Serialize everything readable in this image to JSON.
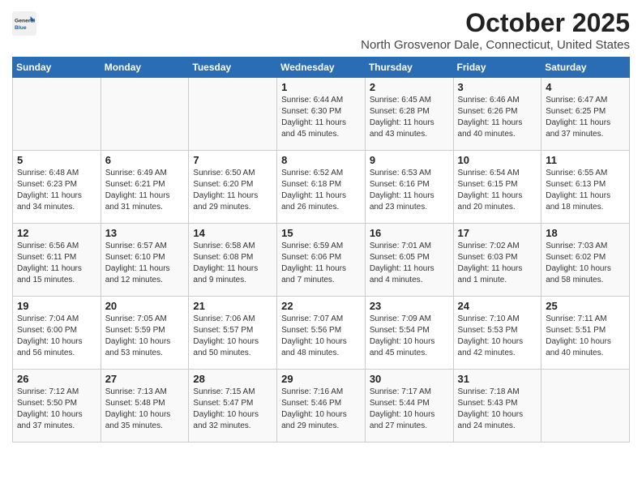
{
  "header": {
    "logo": {
      "general": "General",
      "blue": "Blue"
    },
    "month": "October 2025",
    "location": "North Grosvenor Dale, Connecticut, United States"
  },
  "days_of_week": [
    "Sunday",
    "Monday",
    "Tuesday",
    "Wednesday",
    "Thursday",
    "Friday",
    "Saturday"
  ],
  "weeks": [
    [
      {
        "day": "",
        "empty": true
      },
      {
        "day": "",
        "empty": true
      },
      {
        "day": "",
        "empty": true
      },
      {
        "day": "1",
        "sunrise": "6:44 AM",
        "sunset": "6:30 PM",
        "daylight": "11 hours and 45 minutes."
      },
      {
        "day": "2",
        "sunrise": "6:45 AM",
        "sunset": "6:28 PM",
        "daylight": "11 hours and 43 minutes."
      },
      {
        "day": "3",
        "sunrise": "6:46 AM",
        "sunset": "6:26 PM",
        "daylight": "11 hours and 40 minutes."
      },
      {
        "day": "4",
        "sunrise": "6:47 AM",
        "sunset": "6:25 PM",
        "daylight": "11 hours and 37 minutes."
      }
    ],
    [
      {
        "day": "5",
        "sunrise": "6:48 AM",
        "sunset": "6:23 PM",
        "daylight": "11 hours and 34 minutes."
      },
      {
        "day": "6",
        "sunrise": "6:49 AM",
        "sunset": "6:21 PM",
        "daylight": "11 hours and 31 minutes."
      },
      {
        "day": "7",
        "sunrise": "6:50 AM",
        "sunset": "6:20 PM",
        "daylight": "11 hours and 29 minutes."
      },
      {
        "day": "8",
        "sunrise": "6:52 AM",
        "sunset": "6:18 PM",
        "daylight": "11 hours and 26 minutes."
      },
      {
        "day": "9",
        "sunrise": "6:53 AM",
        "sunset": "6:16 PM",
        "daylight": "11 hours and 23 minutes."
      },
      {
        "day": "10",
        "sunrise": "6:54 AM",
        "sunset": "6:15 PM",
        "daylight": "11 hours and 20 minutes."
      },
      {
        "day": "11",
        "sunrise": "6:55 AM",
        "sunset": "6:13 PM",
        "daylight": "11 hours and 18 minutes."
      }
    ],
    [
      {
        "day": "12",
        "sunrise": "6:56 AM",
        "sunset": "6:11 PM",
        "daylight": "11 hours and 15 minutes."
      },
      {
        "day": "13",
        "sunrise": "6:57 AM",
        "sunset": "6:10 PM",
        "daylight": "11 hours and 12 minutes."
      },
      {
        "day": "14",
        "sunrise": "6:58 AM",
        "sunset": "6:08 PM",
        "daylight": "11 hours and 9 minutes."
      },
      {
        "day": "15",
        "sunrise": "6:59 AM",
        "sunset": "6:06 PM",
        "daylight": "11 hours and 7 minutes."
      },
      {
        "day": "16",
        "sunrise": "7:01 AM",
        "sunset": "6:05 PM",
        "daylight": "11 hours and 4 minutes."
      },
      {
        "day": "17",
        "sunrise": "7:02 AM",
        "sunset": "6:03 PM",
        "daylight": "11 hours and 1 minute."
      },
      {
        "day": "18",
        "sunrise": "7:03 AM",
        "sunset": "6:02 PM",
        "daylight": "10 hours and 58 minutes."
      }
    ],
    [
      {
        "day": "19",
        "sunrise": "7:04 AM",
        "sunset": "6:00 PM",
        "daylight": "10 hours and 56 minutes."
      },
      {
        "day": "20",
        "sunrise": "7:05 AM",
        "sunset": "5:59 PM",
        "daylight": "10 hours and 53 minutes."
      },
      {
        "day": "21",
        "sunrise": "7:06 AM",
        "sunset": "5:57 PM",
        "daylight": "10 hours and 50 minutes."
      },
      {
        "day": "22",
        "sunrise": "7:07 AM",
        "sunset": "5:56 PM",
        "daylight": "10 hours and 48 minutes."
      },
      {
        "day": "23",
        "sunrise": "7:09 AM",
        "sunset": "5:54 PM",
        "daylight": "10 hours and 45 minutes."
      },
      {
        "day": "24",
        "sunrise": "7:10 AM",
        "sunset": "5:53 PM",
        "daylight": "10 hours and 42 minutes."
      },
      {
        "day": "25",
        "sunrise": "7:11 AM",
        "sunset": "5:51 PM",
        "daylight": "10 hours and 40 minutes."
      }
    ],
    [
      {
        "day": "26",
        "sunrise": "7:12 AM",
        "sunset": "5:50 PM",
        "daylight": "10 hours and 37 minutes."
      },
      {
        "day": "27",
        "sunrise": "7:13 AM",
        "sunset": "5:48 PM",
        "daylight": "10 hours and 35 minutes."
      },
      {
        "day": "28",
        "sunrise": "7:15 AM",
        "sunset": "5:47 PM",
        "daylight": "10 hours and 32 minutes."
      },
      {
        "day": "29",
        "sunrise": "7:16 AM",
        "sunset": "5:46 PM",
        "daylight": "10 hours and 29 minutes."
      },
      {
        "day": "30",
        "sunrise": "7:17 AM",
        "sunset": "5:44 PM",
        "daylight": "10 hours and 27 minutes."
      },
      {
        "day": "31",
        "sunrise": "7:18 AM",
        "sunset": "5:43 PM",
        "daylight": "10 hours and 24 minutes."
      },
      {
        "day": "",
        "empty": true
      }
    ]
  ]
}
